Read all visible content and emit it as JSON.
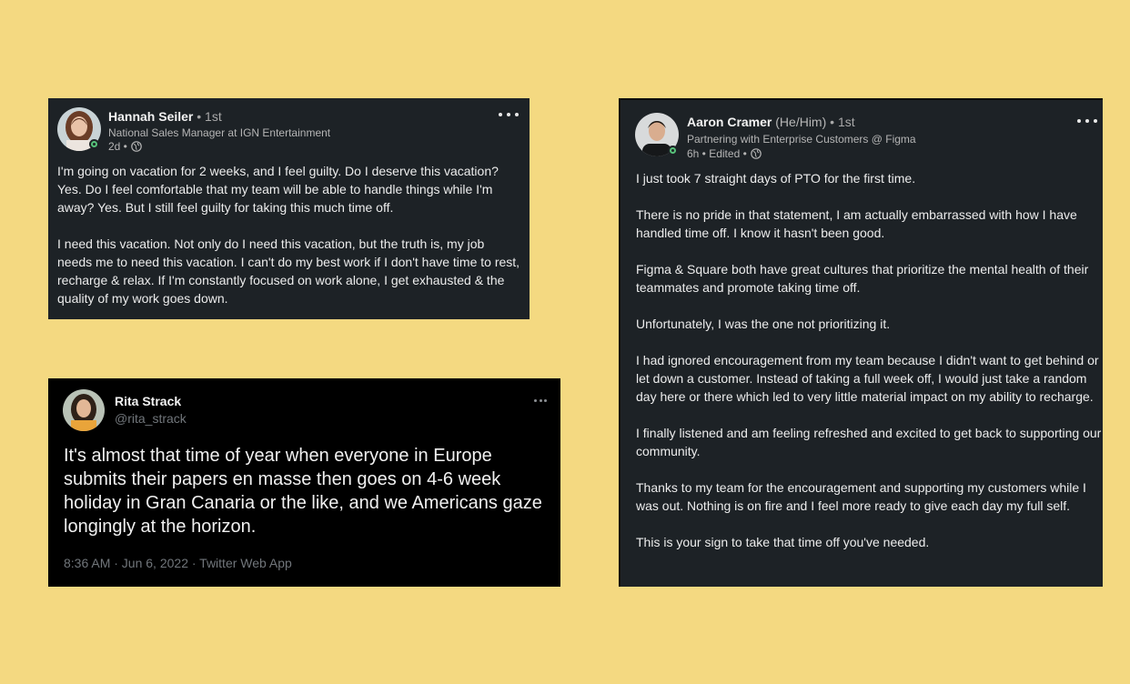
{
  "posts": {
    "hannah": {
      "name": "Hannah Seiler",
      "degree": " • 1st",
      "headline": "National Sales Manager at IGN Entertainment",
      "time": "2d •",
      "paragraphs": [
        "I'm going on vacation for 2 weeks, and I feel guilty. Do I deserve this vacation? Yes. Do I feel comfortable that my team will be able to handle things while I'm away? Yes. But I still feel guilty for taking this much time off.",
        "I need this vacation. Not only do I need this vacation, but the truth is, my job needs me to need this vacation. I can't do my best work if I don't have time to rest, recharge & relax. If I'm constantly focused on work alone, I get exhausted & the quality of my work goes down."
      ]
    },
    "aaron": {
      "name": "Aaron Cramer",
      "pronouns": " (He/Him)",
      "degree": " • 1st",
      "headline": "Partnering with Enterprise Customers @ Figma",
      "time": "6h • Edited •",
      "paragraphs": [
        "I just took 7 straight days of PTO for the first time.",
        "There is no pride in that statement, I am actually embarrassed with how I have handled time off. I know it hasn't been good.",
        "Figma & Square both have great cultures that prioritize the mental health of their teammates and promote taking time off.",
        "Unfortunately, I was the one not prioritizing it.",
        "I had ignored encouragement from my team because I didn't want to get behind or let down a customer. Instead of taking a full week off, I would just take a random day here or there which led to very little material impact on my ability to recharge.",
        "I finally listened and am feeling refreshed and excited to get back to supporting our community.",
        "Thanks to my team for the encouragement and supporting my customers while I was out. Nothing is on fire and I feel more ready to give each day my full self.",
        "This is your sign to take that time off you've needed."
      ]
    },
    "rita": {
      "name": "Rita Strack",
      "handle": "@rita_strack",
      "text": "It's almost that time of year when everyone in Europe submits their papers en masse then goes on 4-6 week holiday in Gran Canaria or the like, and we Americans gaze longingly at the horizon.",
      "footer": "8:36 AM · Jun 6, 2022 · Twitter Web App"
    }
  },
  "icons": {
    "globe": "globe-icon",
    "more": "more-options-icon",
    "online": "online-status-icon"
  },
  "colors": {
    "background": "#f4d981",
    "linkedin_card": "#1d2226",
    "twitter_card": "#000000",
    "online": "#57c27a"
  }
}
